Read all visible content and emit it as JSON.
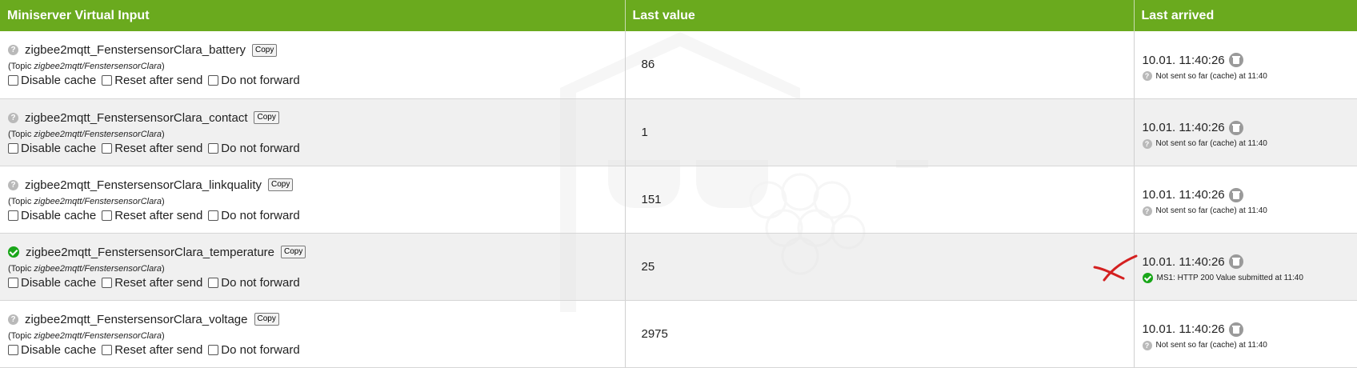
{
  "header": {
    "col_input": "Miniserver Virtual Input",
    "col_value": "Last value",
    "col_arrived": "Last arrived"
  },
  "labels": {
    "copy": "Copy",
    "topic_prefix": "(Topic ",
    "topic_suffix": ")",
    "disable_cache": "Disable cache",
    "reset_after_send": "Reset after send",
    "do_not_forward": "Do not forward"
  },
  "rows": [
    {
      "status_icon": "question-icon",
      "name": "zigbee2mqtt_FenstersensorClara_battery",
      "topic": "zigbee2mqtt/FenstersensorClara",
      "value": "86",
      "arrived": "10.01. 11:40:26",
      "arrived_status_icon": "question-icon",
      "arrived_status": "Not sent so far (cache) at 11:40"
    },
    {
      "status_icon": "question-icon",
      "name": "zigbee2mqtt_FenstersensorClara_contact",
      "topic": "zigbee2mqtt/FenstersensorClara",
      "value": "1",
      "arrived": "10.01. 11:40:26",
      "arrived_status_icon": "question-icon",
      "arrived_status": "Not sent so far (cache) at 11:40"
    },
    {
      "status_icon": "question-icon",
      "name": "zigbee2mqtt_FenstersensorClara_linkquality",
      "topic": "zigbee2mqtt/FenstersensorClara",
      "value": "151",
      "arrived": "10.01. 11:40:26",
      "arrived_status_icon": "question-icon",
      "arrived_status": "Not sent so far (cache) at 11:40"
    },
    {
      "status_icon": "check-circle-icon",
      "name": "zigbee2mqtt_FenstersensorClara_temperature",
      "topic": "zigbee2mqtt/FenstersensorClara",
      "value": "25",
      "arrived": "10.01. 11:40:26",
      "arrived_status_icon": "check-circle-icon",
      "arrived_status": "MS1: HTTP 200 Value submitted at 11:40"
    },
    {
      "status_icon": "question-icon",
      "name": "zigbee2mqtt_FenstersensorClara_voltage",
      "topic": "zigbee2mqtt/FenstersensorClara",
      "value": "2975",
      "arrived": "10.01. 11:40:26",
      "arrived_status_icon": "question-icon",
      "arrived_status": "Not sent so far (cache) at 11:40"
    }
  ],
  "colors": {
    "header_bg": "#6aaa1e",
    "ok": "#19a619",
    "annotation": "#d42020"
  }
}
